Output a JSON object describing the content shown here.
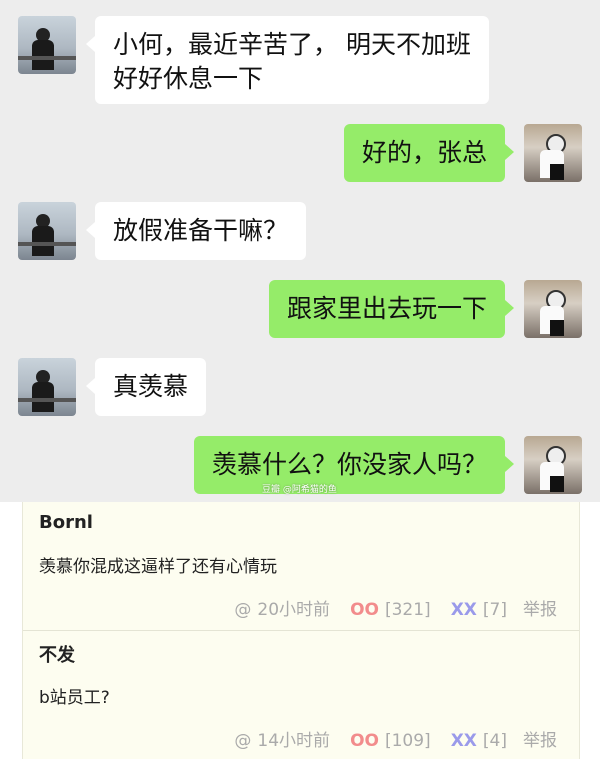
{
  "messages": [
    {
      "side": "left",
      "lines": [
        "小何，最近辛苦了， 明天不加班",
        "好好休息一下"
      ]
    },
    {
      "side": "right",
      "lines": [
        "好的，张总"
      ]
    },
    {
      "side": "left",
      "lines": [
        "放假准备干嘛？"
      ]
    },
    {
      "side": "right",
      "lines": [
        "跟家里出去玩一下"
      ]
    },
    {
      "side": "left",
      "lines": [
        "真羡慕"
      ]
    },
    {
      "side": "right",
      "lines": [
        "羡慕什么？你没家人吗？"
      ]
    }
  ],
  "watermark": "豆瓣 @阿希猫的鱼",
  "comments": [
    {
      "user": "Bornl",
      "text": "羡慕你混成这逼样了还有心情玩",
      "time_icon": "@",
      "time": "20小时前",
      "oo_label": "OO",
      "oo_count": "[321]",
      "xx_label": "XX",
      "xx_count": "[7]",
      "report": "举报"
    },
    {
      "user": "不发",
      "text": "b站员工?",
      "time_icon": "@",
      "time": "14小时前",
      "oo_label": "OO",
      "oo_count": "[109]",
      "xx_label": "XX",
      "xx_count": "[4]",
      "report": "举报"
    }
  ],
  "colors": {
    "chat_bg": "#ededed",
    "bubble_self": "#95ec69",
    "bubble_other": "#ffffff",
    "comment_bg": "#fdfdf0",
    "oo": "#f28c8c",
    "xx": "#9a9aea"
  }
}
